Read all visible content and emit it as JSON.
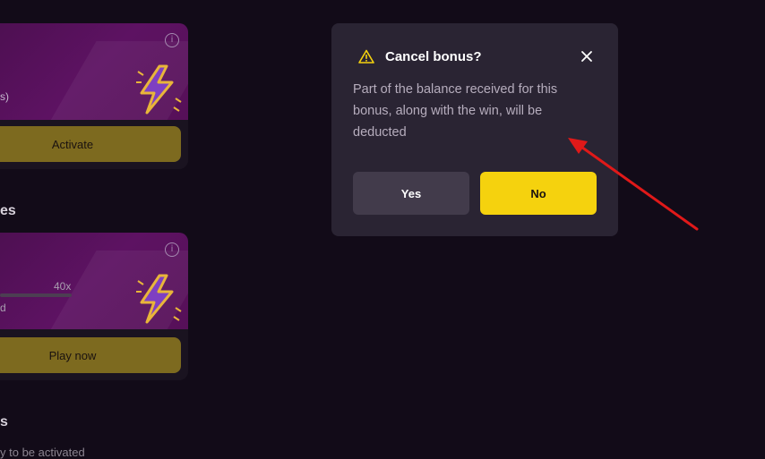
{
  "bonus_card_1": {
    "info_icon": "i",
    "partial_text": "s)",
    "button_label": "Activate"
  },
  "section_1": {
    "title_partial": "es"
  },
  "bonus_card_2": {
    "info_icon": "i",
    "wager_label": "40x",
    "partial_text": "d",
    "button_label": "Play now"
  },
  "section_2": {
    "title_partial": "s",
    "subtitle_partial": "y to be activated"
  },
  "dialog": {
    "title": "Cancel bonus?",
    "message": "Part of the balance received for this bonus, along with the win, will be deducted",
    "yes_label": "Yes",
    "no_label": "No",
    "close_icon": "close-icon",
    "warning_icon": "warning-icon"
  },
  "colors": {
    "background": "#120b18",
    "dialog_bg": "#2a2433",
    "accent_yellow": "#f5d20e",
    "secondary_button": "#423b4b",
    "card_banner": "#5d1262",
    "annotation_arrow": "#e01919"
  }
}
